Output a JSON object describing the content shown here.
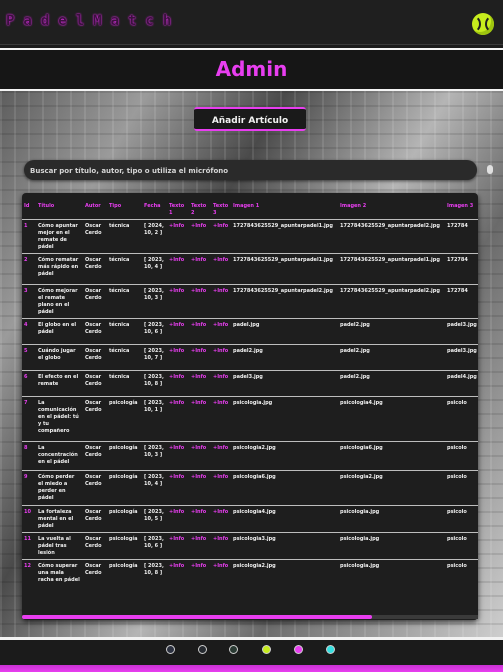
{
  "brand": "PadelMatch",
  "page_title": "Admin",
  "add_button_label": "Añadir Artículo",
  "search_placeholder": "Buscar por título, autor, tipo o utiliza el micrófono",
  "table": {
    "headers": [
      "Id",
      "Título",
      "Autor",
      "Tipo",
      "Fecha",
      "Texto 1",
      "Texto 2",
      "Texto 3",
      "Imagen 1",
      "Imagen 2",
      "Imagen 3"
    ],
    "rows": [
      [
        "1",
        "Cómo apuntar mejor en el remate de pádel",
        "Oscar Cerdo",
        "técnica",
        "[ 2024, 10, 2 ]",
        "+Info",
        "+Info",
        "+Info",
        "1727843625529_apuntarpadel1.jpg",
        "1727843625529_apuntarpadel2.jpg",
        "172784"
      ],
      [
        "2",
        "Cómo rematar más rápido en pádel",
        "Oscar Cerdo",
        "técnica",
        "[ 2023, 10, 4 ]",
        "+Info",
        "+Info",
        "+Info",
        "1727843625529_apuntarpadel1.jpg",
        "1727843625529_apuntarpadel1.jpg",
        "172784"
      ],
      [
        "3",
        "Cómo mejorar el remate plano en el pádel",
        "Oscar Cerdo",
        "técnica",
        "[ 2023, 10, 3 ]",
        "+Info",
        "+Info",
        "+Info",
        "1727843625529_apuntarpadel2.jpg",
        "1727843625529_apuntarpadel2.jpg",
        "172784"
      ],
      [
        "4",
        "El globo en el pádel",
        "Oscar Cerdo",
        "técnica",
        "[ 2023, 10, 6 ]",
        "+Info",
        "+Info",
        "+Info",
        "padel.jpg",
        "padel2.jpg",
        "padel3.jpg"
      ],
      [
        "5",
        "Cuándo jugar el globo",
        "Oscar Cerdo",
        "técnica",
        "[ 2023, 10, 7 ]",
        "+Info",
        "+Info",
        "+Info",
        "padel2.jpg",
        "padel2.jpg",
        "padel3.jpg"
      ],
      [
        "6",
        "El efecto en el remate",
        "Oscar Cerdo",
        "técnica",
        "[ 2023, 10, 8 ]",
        "+Info",
        "+Info",
        "+Info",
        "padel3.jpg",
        "padel2.jpg",
        "padel4.jpg"
      ],
      [
        "7",
        "La comunicación en el pádel: tú y tu compañero",
        "Oscar Cerdo",
        "psicología",
        "[ 2023, 10, 1 ]",
        "+Info",
        "+Info",
        "+Info",
        "psicologia.jpg",
        "psicologia4.jpg",
        "psicolo"
      ],
      [
        "8",
        "La concentración en el pádel",
        "Oscar Cerdo",
        "psicología",
        "[ 2023, 10, 3 ]",
        "+Info",
        "+Info",
        "+Info",
        "psicologia2.jpg",
        "psicologia6.jpg",
        "psicolo"
      ],
      [
        "9",
        "Cómo perder el miedo a perder en pádel",
        "Oscar Cerdo",
        "psicología",
        "[ 2023, 10, 4 ]",
        "+Info",
        "+Info",
        "+Info",
        "psicologia6.jpg",
        "psicologia2.jpg",
        "psicolo"
      ],
      [
        "10",
        "La fortaleza mental en el pádel",
        "Oscar Cerdo",
        "psicología",
        "[ 2023, 10, 5 ]",
        "+Info",
        "+Info",
        "+Info",
        "psicologia4.jpg",
        "psicologia.jpg",
        "psicolo"
      ],
      [
        "11",
        "La vuelta al pádel tras lesión",
        "Oscar Cerdo",
        "psicología",
        "[ 2023, 10, 6 ]",
        "+Info",
        "+Info",
        "+Info",
        "psicologia3.jpg",
        "psicologia.jpg",
        "psicolo"
      ],
      [
        "12",
        "Cómo superar una mala racha en pádel",
        "Oscar Cerdo",
        "psicología",
        "[ 2023, 10, 8 ]",
        "+Info",
        "+Info",
        "+Info",
        "psicologia2.jpg",
        "psicologia.jpg",
        "psicolo"
      ]
    ]
  },
  "theme_dots": [
    {
      "name": "theme-dot-dark-1",
      "color": "#2c3140"
    },
    {
      "name": "theme-dot-dark-2",
      "color": "#262a30"
    },
    {
      "name": "theme-dot-dark-3",
      "color": "#2a3a33"
    },
    {
      "name": "theme-dot-lime",
      "color": "#c7ec1d"
    },
    {
      "name": "theme-dot-pink",
      "color": "#e83ef0"
    },
    {
      "name": "theme-dot-cyan",
      "color": "#35dfe0"
    }
  ],
  "accent_color": "#e83ef0"
}
